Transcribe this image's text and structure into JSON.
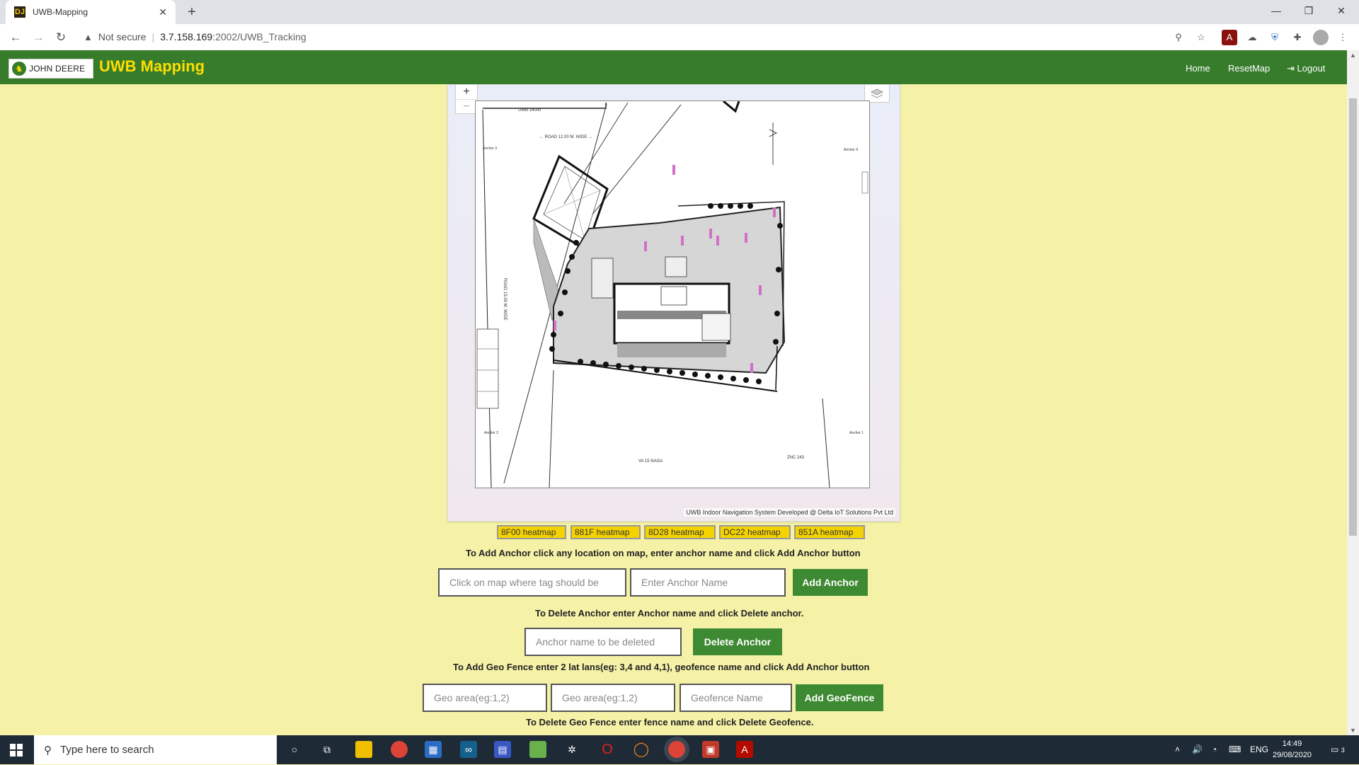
{
  "browser": {
    "tab_title": "UWB-Mapping",
    "tab_favicon": "DJ",
    "new_tab": "+",
    "security_label": "Not secure",
    "url_host": "3.7.158.169",
    "url_rest": ":2002/UWB_Tracking"
  },
  "navbar": {
    "logo_text": "JOHN DEERE",
    "brand": "UWB Mapping",
    "links": [
      "Home",
      "ResetMap",
      "Logout"
    ]
  },
  "map": {
    "zoom_in": "+",
    "zoom_out": "−",
    "attribution": "UWB Indoor Navigation System Developed @ Delta IoT Solutions Pvt Ltd",
    "plan_labels": {
      "anchor1": "Anchor 1",
      "anchor2": "Anchor 2",
      "anchor3": "Anchor 3",
      "anchor4": "Anchor 4"
    }
  },
  "heatmaps": [
    "8F00 heatmap",
    "881F heatmap",
    "8D28 heatmap",
    "DC22 heatmap",
    "851A heatmap"
  ],
  "anchor_add": {
    "instruction": "To Add Anchor click any location on map, enter anchor name and click Add Anchor button",
    "location_placeholder": "Click on map where tag should be",
    "name_placeholder": "Enter Anchor Name",
    "button": "Add Anchor"
  },
  "anchor_delete": {
    "instruction": "To Delete Anchor enter Anchor name and click Delete anchor.",
    "name_placeholder": "Anchor name to be deleted",
    "button": "Delete Anchor"
  },
  "geofence_add": {
    "instruction": "To Add Geo Fence enter 2 lat lans(eg: 3,4 and 4,1), geofence name and click Add Anchor button",
    "area1_placeholder": "Geo area(eg:1,2)",
    "area2_placeholder": "Geo area(eg:1,2)",
    "name_placeholder": "Geofence Name",
    "button": "Add GeoFence"
  },
  "geofence_delete": {
    "instruction": "To Delete Geo Fence enter fence name and click Delete Geofence."
  },
  "taskbar": {
    "search_placeholder": "Type here to search",
    "language": "ENG",
    "time": "14:49",
    "date": "29/08/2020",
    "notification_count": "3"
  },
  "colors": {
    "navbar": "#367c2b",
    "brand": "#ffde00",
    "page_bg": "#f5f2a8",
    "button": "#3e8a32",
    "heatmap_button": "#f5d300"
  }
}
